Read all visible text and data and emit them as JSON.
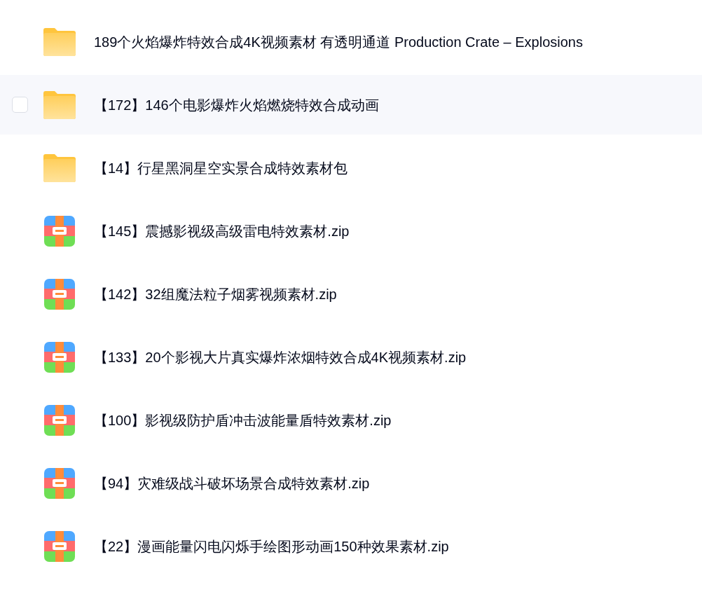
{
  "files": [
    {
      "kind": "folder",
      "name": "189个火焰爆炸特效合成4K视频素材 有透明通道 Production Crate – Explosions",
      "hovered": false
    },
    {
      "kind": "folder",
      "name": "【172】146个电影爆炸火焰燃烧特效合成动画",
      "hovered": true,
      "checked": false
    },
    {
      "kind": "folder",
      "name": "【14】行星黑洞星空实景合成特效素材包",
      "hovered": false
    },
    {
      "kind": "zip",
      "name": "【145】震撼影视级高级雷电特效素材.zip",
      "hovered": false
    },
    {
      "kind": "zip",
      "name": "【142】32组魔法粒子烟雾视频素材.zip",
      "hovered": false
    },
    {
      "kind": "zip",
      "name": "【133】20个影视大片真实爆炸浓烟特效合成4K视频素材.zip",
      "hovered": false
    },
    {
      "kind": "zip",
      "name": "【100】影视级防护盾冲击波能量盾特效素材.zip",
      "hovered": false
    },
    {
      "kind": "zip",
      "name": "【94】灾难级战斗破坏场景合成特效素材.zip",
      "hovered": false
    },
    {
      "kind": "zip",
      "name": "【22】漫画能量闪电闪烁手绘图形动画150种效果素材.zip",
      "hovered": false
    }
  ]
}
